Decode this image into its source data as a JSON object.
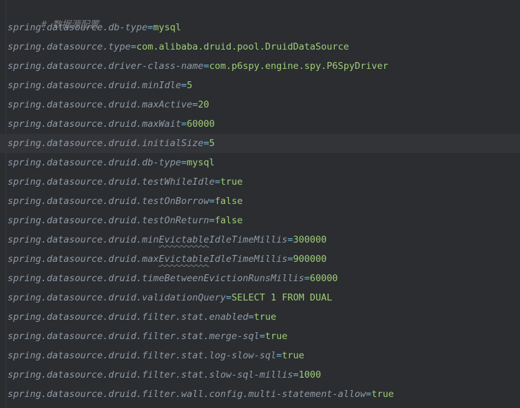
{
  "editor": {
    "comment": "# 数据源配置",
    "lines": [
      {
        "key": "spring.datasource.db-type",
        "eq": "=",
        "value": "mysql"
      },
      {
        "key": "spring.datasource.type",
        "eq": "=",
        "value": "com.alibaba.druid.pool.DruidDataSource"
      },
      {
        "key": "spring.datasource.driver-class-name",
        "eq": "=",
        "value": "com.p6spy.engine.spy.P6SpyDriver"
      },
      {
        "key": "spring.datasource.druid.minIdle",
        "eq": "=",
        "value": "5"
      },
      {
        "key": "spring.datasource.druid.maxActive",
        "eq": "=",
        "value": "20"
      },
      {
        "key": "spring.datasource.druid.maxWait",
        "eq": "=",
        "value": "60000"
      },
      {
        "key": "spring.datasource.druid.initialSize",
        "eq": "=",
        "value": "5"
      },
      {
        "key": "spring.datasource.druid.db-type",
        "eq": "=",
        "value": "mysql"
      },
      {
        "key": "spring.datasource.druid.testWhileIdle",
        "eq": "=",
        "value": "true"
      },
      {
        "key": "spring.datasource.druid.testOnBorrow",
        "eq": "=",
        "value": "false"
      },
      {
        "key": "spring.datasource.druid.testOnReturn",
        "eq": "=",
        "value": "false"
      },
      {
        "key_pre": "spring.datasource.druid.min",
        "key_typo": "Evictable",
        "key_post": "IdleTimeMillis",
        "eq": "=",
        "value": "300000"
      },
      {
        "key_pre": "spring.datasource.druid.max",
        "key_typo": "Evictable",
        "key_post": "IdleTimeMillis",
        "eq": "=",
        "value": "900000"
      },
      {
        "key": "spring.datasource.druid.timeBetweenEvictionRunsMillis",
        "eq": "=",
        "value": "60000"
      },
      {
        "key": "spring.datasource.druid.validationQuery",
        "eq": "=",
        "value": "SELECT 1 FROM DUAL"
      },
      {
        "key": "spring.datasource.druid.filter.stat.enabled",
        "eq": "=",
        "value": "true"
      },
      {
        "key": "spring.datasource.druid.filter.stat.merge-sql",
        "eq": "=",
        "value": "true"
      },
      {
        "key": "spring.datasource.druid.filter.stat.log-slow-sql",
        "eq": "=",
        "value": "true"
      },
      {
        "key": "spring.datasource.druid.filter.stat.slow-sql-millis",
        "eq": "=",
        "value": "1000"
      },
      {
        "key": "spring.datasource.druid.filter.wall.config.multi-statement-allow",
        "eq": "=",
        "value": "true"
      }
    ]
  }
}
